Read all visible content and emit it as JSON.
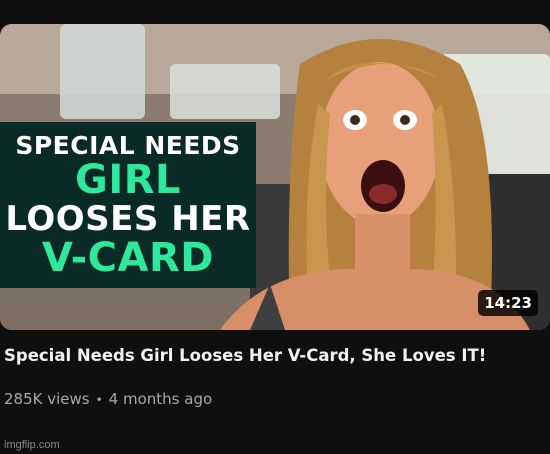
{
  "thumbnail": {
    "overlay_lines": [
      "SPECIAL NEEDS",
      "GIRL",
      "LOOSES HER",
      "V-CARD"
    ],
    "overlay_colors": {
      "panel": "#0a2a25",
      "white": "#ffffff",
      "green": "#2ee89b"
    },
    "duration": "14:23"
  },
  "video": {
    "title": "Special Needs Girl Looses Her V-Card, She Loves IT!",
    "views": "285K views",
    "separator": "•",
    "age": "4 months ago"
  },
  "watermark": "imgflip.com",
  "colors": {
    "background": "#0f0f0f",
    "title_text": "#f1f1f1",
    "meta_text": "#a8a8a8"
  }
}
